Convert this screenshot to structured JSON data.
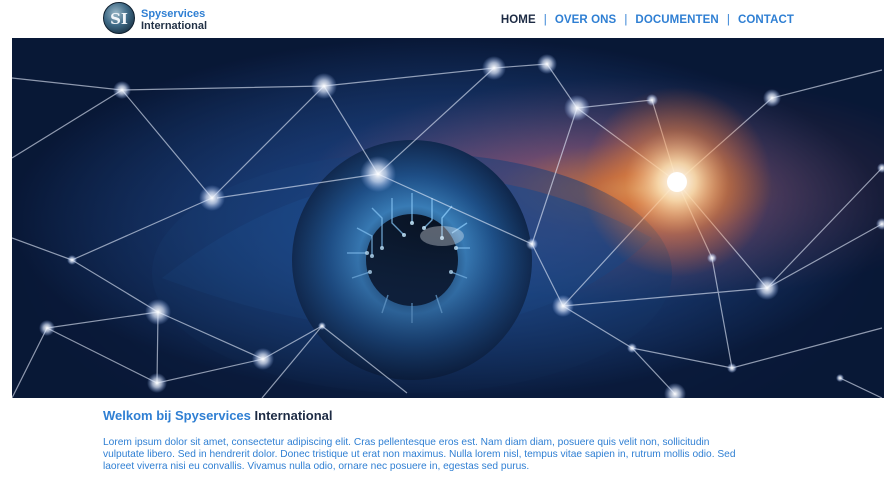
{
  "header": {
    "logo": {
      "line1": "Spyservices",
      "line2": "International",
      "mark_text": "SI"
    },
    "nav": {
      "items": [
        "HOME",
        "OVER ONS",
        "DOCUMENTEN",
        "CONTACT"
      ],
      "separator": "|",
      "active": "HOME"
    }
  },
  "hero": {
    "image": "eye-network-image"
  },
  "main": {
    "welcome_part1": "Welkom bij Spyservices",
    "welcome_part2": "International",
    "intro": "Lorem ipsum dolor sit amet, consectetur adipiscing elit. Cras pellentesque eros est. Nam diam diam, posuere quis velit non, sollicitudin vulputate libero. Sed in hendrerit dolor. Donec tristique ut erat non maximus. Nulla lorem nisl, tempus vitae sapien in, rutrum mollis odio. Sed laoreet viverra nisi eu convallis. Vivamus nulla odio, ornare nec posuere in, egestas sed purus."
  },
  "colors": {
    "accent": "#2f7fd3",
    "dark": "#1d2b44"
  }
}
